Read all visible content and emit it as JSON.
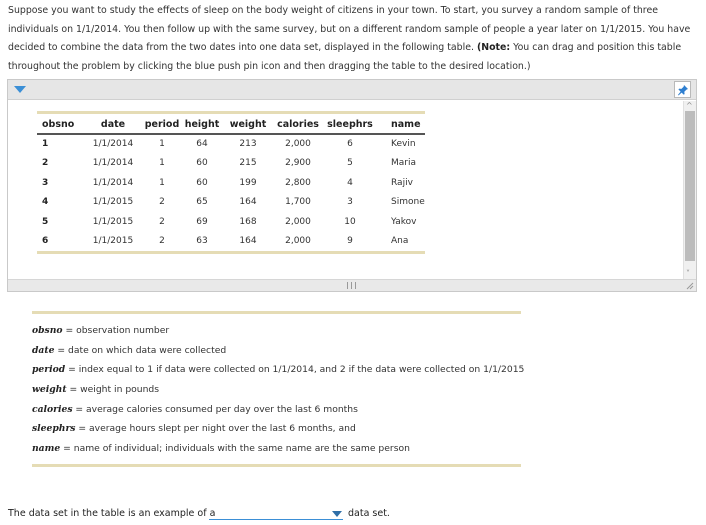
{
  "intro": {
    "text": "Suppose you want to study the effects of sleep on the body weight of citizens in your town. To start, you survey a random sample of three individuals on 1/1/2014. You then follow up with the same survey, but on a different random sample of people a year later on 1/1/2015. You have decided to combine the data from the two dates into one data set, displayed in the following table. ",
    "note_label": "(Note:",
    "note_text": " You can drag and position this table throughout the problem by clicking the blue push pin icon and then dragging the table to the desired location.)"
  },
  "panel": {
    "toggle_icon": "triangle-down-icon",
    "pin_icon": "push-pin-icon",
    "accent_color": "#3b8fd6"
  },
  "table": {
    "columns": [
      "obsno",
      "date",
      "period",
      "height",
      "weight",
      "calories",
      "sleephrs",
      "name"
    ],
    "rows": [
      [
        "1",
        "1/1/2014",
        "1",
        "64",
        "213",
        "2,000",
        "6",
        "Kevin"
      ],
      [
        "2",
        "1/1/2014",
        "1",
        "60",
        "215",
        "2,900",
        "5",
        "Maria"
      ],
      [
        "3",
        "1/1/2014",
        "1",
        "60",
        "199",
        "2,800",
        "4",
        "Rajiv"
      ],
      [
        "4",
        "1/1/2015",
        "2",
        "65",
        "164",
        "1,700",
        "3",
        "Simone"
      ],
      [
        "5",
        "1/1/2015",
        "2",
        "69",
        "168",
        "2,000",
        "10",
        "Yakov"
      ],
      [
        "6",
        "1/1/2015",
        "2",
        "63",
        "164",
        "2,000",
        "9",
        "Ana"
      ]
    ]
  },
  "definitions": [
    {
      "var": "obsno",
      "text": " = observation number"
    },
    {
      "var": "date",
      "text": " = date on which data were collected"
    },
    {
      "var": "period",
      "text": " = index equal to 1 if data were collected on 1/1/2014, and 2 if the data were collected on 1/1/2015"
    },
    {
      "var": "weight",
      "text": " = weight in pounds"
    },
    {
      "var": "calories",
      "text": " = average calories consumed per day over the last 6 months"
    },
    {
      "var": "sleephrs",
      "text": " = average hours slept per night over the last 6 months, and"
    },
    {
      "var": "name",
      "text": " = name of individual; individuals with the same name are the same person"
    }
  ],
  "question": {
    "prefix": "The data set in the table is an example of a",
    "selected_value": "",
    "suffix": "data set."
  }
}
